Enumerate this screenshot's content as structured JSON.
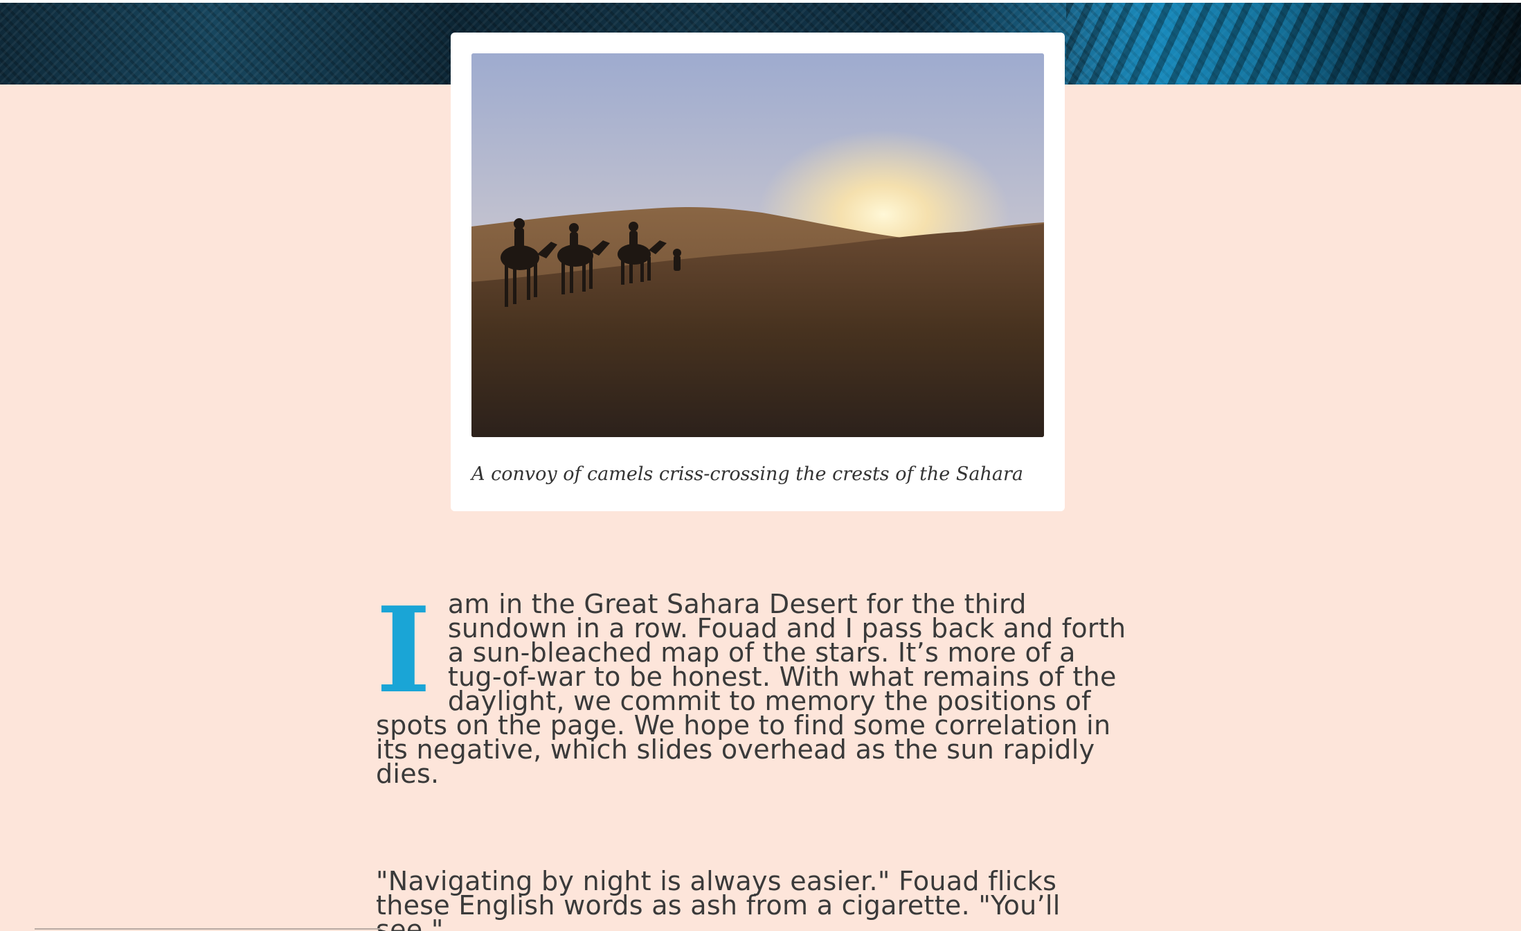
{
  "colors": {
    "page_background": "#fde5da",
    "accent": "#1aa5d6",
    "text": "#3a3a3a",
    "card_background": "#ffffff"
  },
  "figure": {
    "image_description_icon": "desert-camels-photo",
    "caption": "A convoy of camels criss-crossing the crests of the Sahara"
  },
  "article": {
    "drop_cap": "I",
    "paragraph_1": "am in the Great Sahara Desert for the third sundown in a row. Fouad and I pass back and forth a sun-bleached map of the stars. It’s more of a tug-of-war to be honest. With what remains of the daylight, we commit to memory the positions of spots on the page. We hope to find some correlation in its negative, which slides overhead as the sun rapidly dies.",
    "paragraph_2": "\"Navigating by night is always easier.\" Fouad flicks these English words as ash from a cigarette. \"You’ll see.\""
  }
}
